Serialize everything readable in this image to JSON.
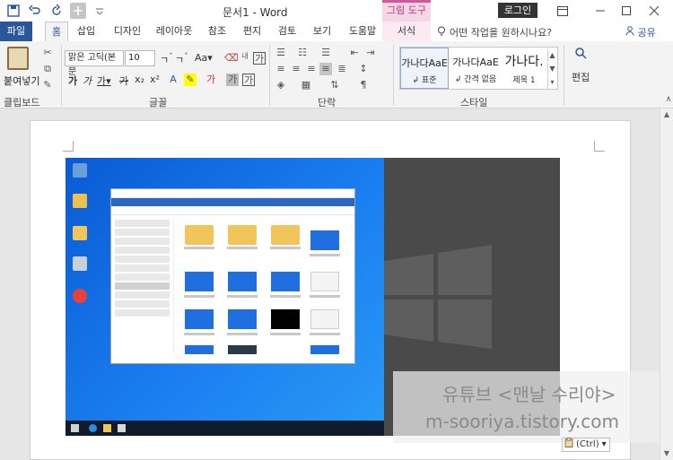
{
  "window": {
    "title": "문서1 - Word",
    "login_label": "로그인",
    "minimize_icon": "minimize-icon",
    "maximize_icon": "maximize-icon",
    "close_icon": "close-icon"
  },
  "quick_access": [
    "save-icon",
    "undo-icon",
    "redo-icon",
    "touch-mode-icon",
    "customize-icon"
  ],
  "contextual_tab_group": "그림 도구",
  "tabs": [
    {
      "label": "파일"
    },
    {
      "label": "홈"
    },
    {
      "label": "삽입"
    },
    {
      "label": "디자인"
    },
    {
      "label": "레이아웃"
    },
    {
      "label": "참조"
    },
    {
      "label": "편지"
    },
    {
      "label": "검토"
    },
    {
      "label": "보기"
    },
    {
      "label": "도움말"
    },
    {
      "label": "서식"
    }
  ],
  "active_tab": "홈",
  "tell_me": "어떤 작업을 원하시나요?",
  "share": "공유",
  "ribbon": {
    "clipboard": {
      "paste_label": "붙여넣기",
      "group_label": "클립보드"
    },
    "font": {
      "font_name": "맑은 고딕(본문",
      "font_size": "10",
      "group_label": "글꼴"
    },
    "paragraph": {
      "group_label": "단락"
    },
    "styles": {
      "items": [
        {
          "sample": "가나다AaE",
          "name": "↲ 표준"
        },
        {
          "sample": "가나다AaE",
          "name": "↲ 간격 없음"
        },
        {
          "sample": "가나다.",
          "name": "제목 1"
        }
      ],
      "group_label": "스타일"
    },
    "editing": {
      "label": "편집"
    }
  },
  "paste_options": "(Ctrl)",
  "watermark": {
    "line1": "유튜브 <맨날 수리야>",
    "line2": "m-sooriya.tistory.com"
  }
}
